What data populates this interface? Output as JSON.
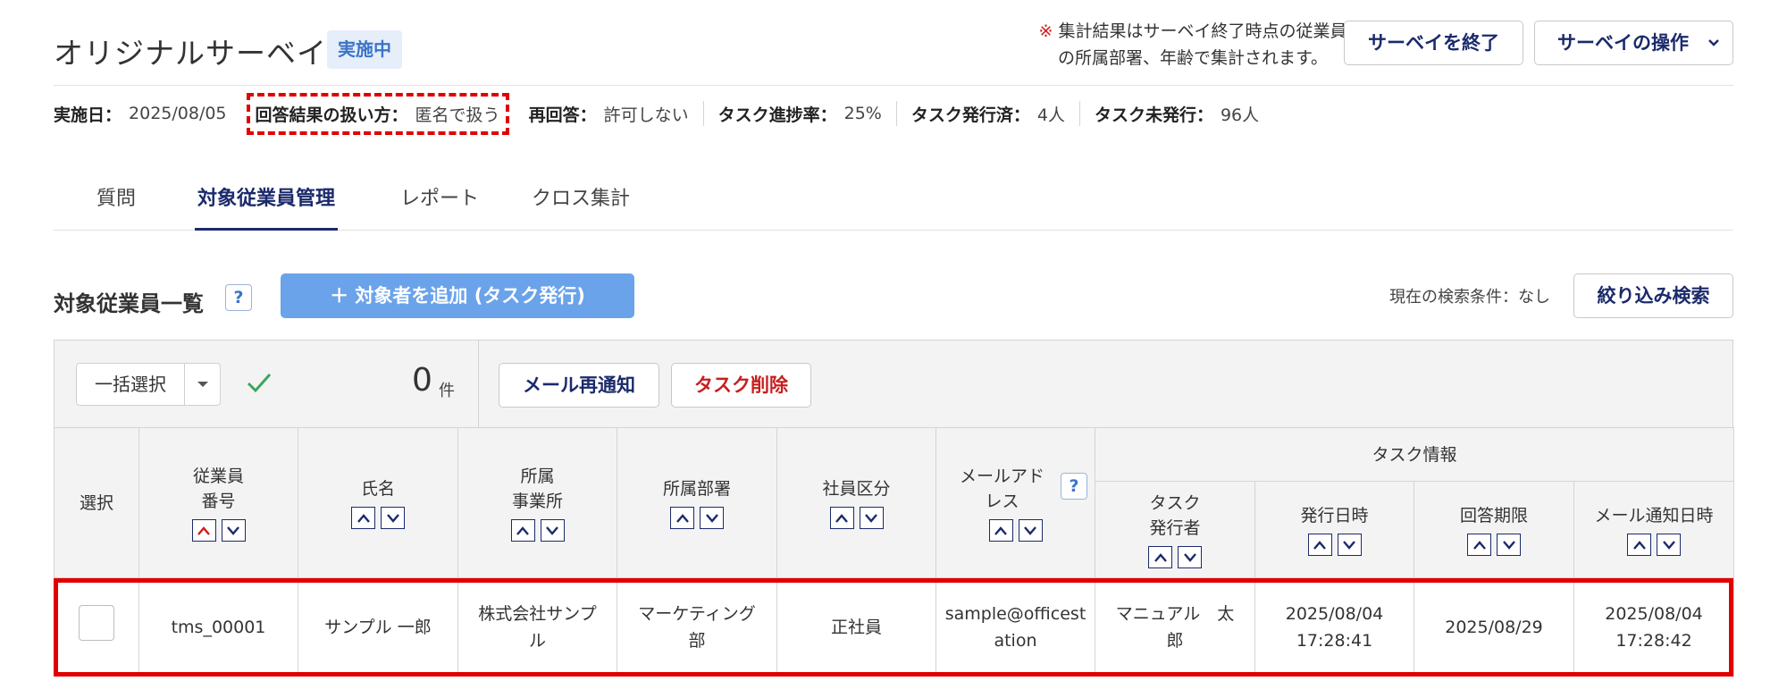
{
  "header": {
    "title": "オリジナルサーベイ",
    "status": "実施中",
    "notice_mark": "※",
    "notice_line1": "集計結果はサーベイ終了時点の従業員",
    "notice_line2": "の所属部署、年齢で集計されます。",
    "end_button": "サーベイを終了",
    "ops_button": "サーベイの操作"
  },
  "meta": {
    "date_label": "実施日：",
    "date_value": "2025/08/05",
    "handling_label": "回答結果の扱い方：",
    "handling_value": "匿名で扱う",
    "reanswer_label": "再回答：",
    "reanswer_value": "許可しない",
    "progress_label": "タスク進捗率：",
    "progress_value": "25%",
    "issued_label": "タスク発行済：",
    "issued_value": "4人",
    "unissued_label": "タスク未発行：",
    "unissued_value": "96人"
  },
  "tabs": [
    "質問",
    "対象従業員管理",
    "レポート",
    "クロス集計"
  ],
  "section": {
    "title": "対象従業員一覧",
    "help": "?",
    "add_button": "＋ 対象者を追加 (タスク発行)",
    "condition": "現在の検索条件：なし",
    "filter_button": "絞り込み検索"
  },
  "toolbar": {
    "bulk_select": "一括選択",
    "count": "0",
    "count_unit": "件",
    "mail_button": "メール再通知",
    "delete_button": "タスク削除"
  },
  "table": {
    "headers": {
      "select": "選択",
      "employee_no_1": "従業員",
      "employee_no_2": "番号",
      "name": "氏名",
      "office_1": "所属",
      "office_2": "事業所",
      "dept": "所属部署",
      "type": "社員区分",
      "mail_1": "メールアド",
      "mail_2": "レス",
      "task_info": "タスク情報",
      "issuer_1": "タスク",
      "issuer_2": "発行者",
      "issued_at": "発行日時",
      "deadline": "回答期限",
      "notified_at": "メール通知日時"
    },
    "row": {
      "employee_no": "tms_00001",
      "name": "サンプル 一郎",
      "office_1": "株式会社サンプ",
      "office_2": "ル",
      "dept_1": "マーケティング",
      "dept_2": "部",
      "type": "正社員",
      "mail_1": "sample@officest",
      "mail_2": "ation",
      "issuer_1": "マニュアル　太",
      "issuer_2": "郎",
      "issued_1": "2025/08/04",
      "issued_2": "17:28:41",
      "deadline": "2025/08/29",
      "notified_1": "2025/08/04",
      "notified_2": "17:28:42"
    }
  },
  "colors": {
    "navy": "#1b2a6b",
    "accent_blue": "#6ba3ea",
    "highlight_red": "#e00000",
    "check_green": "#3aa65a"
  }
}
